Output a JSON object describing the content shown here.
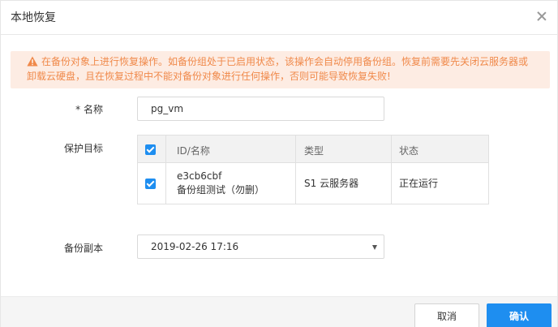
{
  "dialog": {
    "title": "本地恢复"
  },
  "warning": {
    "line1": "在备份对象上进行恢复操作。如备份组处于已启用状态，该操作会自动停用备份组。恢复前需要先关闭云服务器或",
    "line2": "卸载云硬盘，且在恢复过程中不能对备份对象进行任何操作，否则可能导致恢复失败!",
    "color": "#f0894a",
    "background": "#fdece3"
  },
  "form": {
    "name_label": "* 名称",
    "name_value": "pg_vm",
    "target_label": "保护目标",
    "copy_label": "备份副本",
    "copy_value": "2019-02-26 17:16"
  },
  "table": {
    "headers": {
      "id_name": "ID/名称",
      "type": "类型",
      "status": "状态"
    },
    "rows": [
      {
        "id": "e3cb6cbf",
        "name": "备份组测试（勿删）",
        "type": "S1 云服务器",
        "status": "正在运行",
        "checked": true
      }
    ]
  },
  "footer": {
    "cancel_label": "取消",
    "ok_label": "确认"
  },
  "colors": {
    "primary": "#1e8ef0"
  }
}
